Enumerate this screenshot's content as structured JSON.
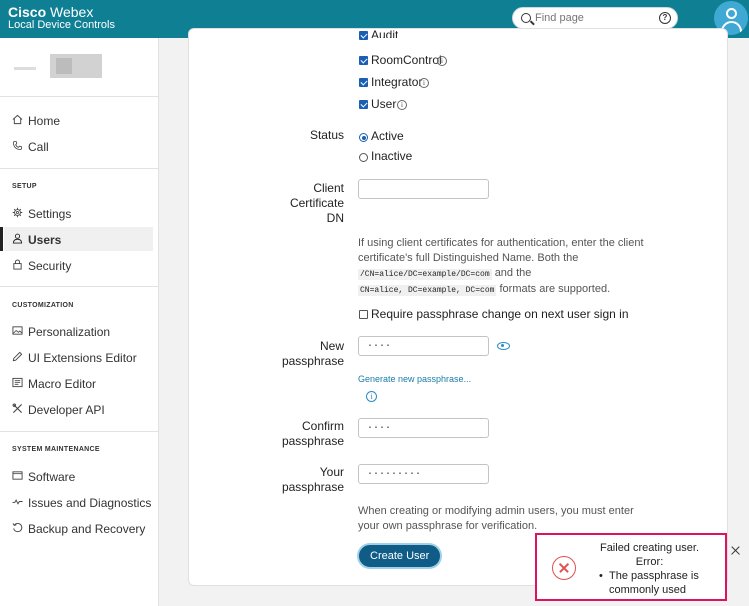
{
  "header": {
    "brand_bold": "Cisco",
    "brand_light": "Webex",
    "subtitle": "Local Device Controls",
    "search_placeholder": "Find page",
    "help_glyph": "?"
  },
  "sidebar": {
    "main_items": [
      {
        "label": "Home",
        "icon": "home-icon"
      },
      {
        "label": "Call",
        "icon": "phone-icon"
      }
    ],
    "sections": [
      {
        "title": "SETUP",
        "items": [
          {
            "label": "Settings",
            "icon": "gear-icon"
          },
          {
            "label": "Users",
            "icon": "user-icon",
            "active": true
          },
          {
            "label": "Security",
            "icon": "lock-icon"
          }
        ]
      },
      {
        "title": "CUSTOMIZATION",
        "items": [
          {
            "label": "Personalization",
            "icon": "image-icon"
          },
          {
            "label": "UI Extensions Editor",
            "icon": "pencil-icon"
          },
          {
            "label": "Macro Editor",
            "icon": "macro-icon"
          },
          {
            "label": "Developer API",
            "icon": "tools-icon"
          }
        ]
      },
      {
        "title": "SYSTEM MAINTENANCE",
        "items": [
          {
            "label": "Software",
            "icon": "software-icon"
          },
          {
            "label": "Issues and Diagnostics",
            "icon": "pulse-icon"
          },
          {
            "label": "Backup and Recovery",
            "icon": "restore-icon"
          }
        ]
      }
    ]
  },
  "form": {
    "roles": [
      {
        "label": "Audit",
        "checked": true
      },
      {
        "label": "RoomControl",
        "checked": true
      },
      {
        "label": "Integrator",
        "checked": true
      },
      {
        "label": "User",
        "checked": true
      }
    ],
    "status_label": "Status",
    "status_options": [
      {
        "label": "Active",
        "selected": true
      },
      {
        "label": "Inactive",
        "selected": false
      }
    ],
    "cert_label_lines": [
      "Client",
      "Certificate",
      "DN"
    ],
    "cert_value": "",
    "cert_help": {
      "line1": "If using client certificates for authentication, enter the client",
      "line2": "certificate's full Distinguished Name. Both the",
      "code1": "/CN=alice/DC=example/DC=com",
      "and": "and the",
      "code2": "CN=alice, DC=example, DC=com",
      "tail": "formats are supported."
    },
    "require_change_label": "Require passphrase change on next user sign in",
    "new_pass_label_lines": [
      "New",
      "passphrase"
    ],
    "new_pass_value": "····",
    "generate_link": "Generate new passphrase...",
    "confirm_label_lines": [
      "Confirm",
      "passphrase"
    ],
    "confirm_value": "····",
    "your_label_lines": [
      "Your",
      "passphrase"
    ],
    "your_value": "·········",
    "admin_note_line1": "When creating or modifying admin users, you must enter",
    "admin_note_line2": "your own passphrase for verification.",
    "create_button": "Create User"
  },
  "toast": {
    "title": "Failed creating user. Error:",
    "error": "The passphrase is commonly used"
  },
  "colors": {
    "header_bg": "#0f7f94",
    "primary_button": "#0f5c87",
    "toast_border": "#e0115f",
    "error_icon": "#e05050"
  }
}
